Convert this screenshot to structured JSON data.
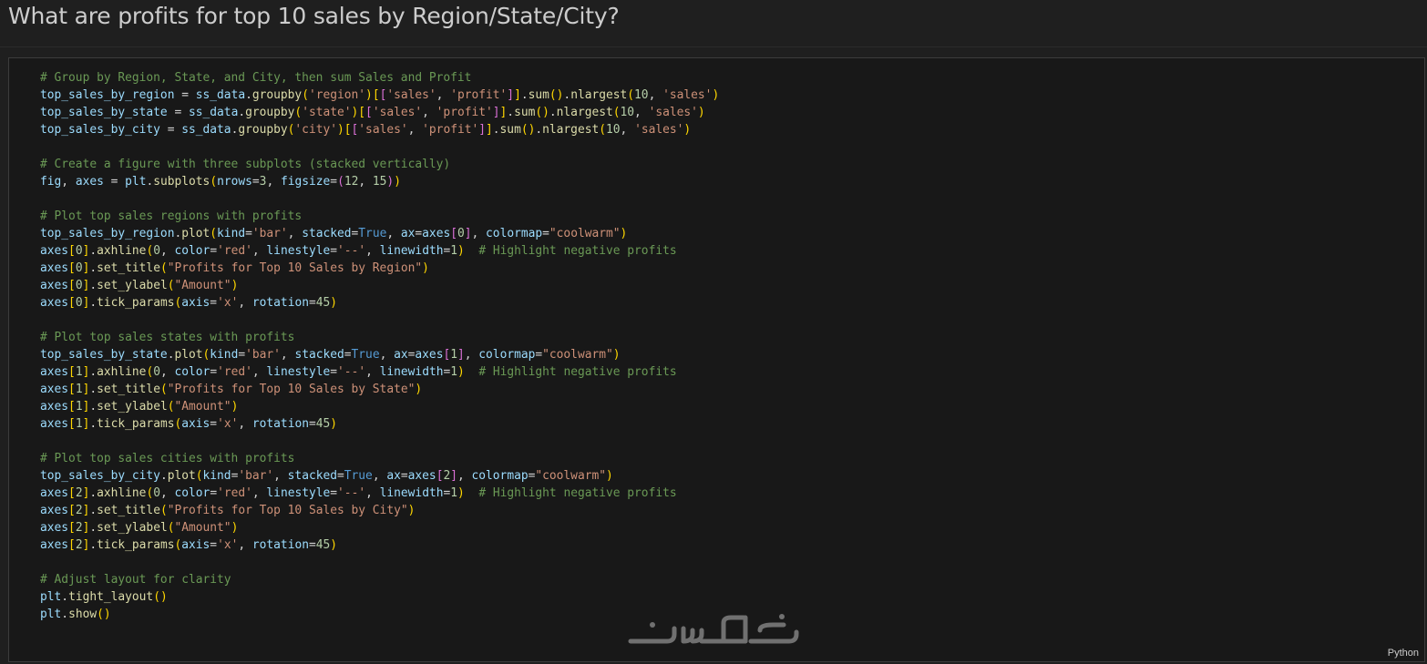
{
  "cell_heading": "What are profits for top 10 sales by Region/State/City?",
  "language_label": "Python",
  "watermark_text": "خدسات",
  "code_lines": [
    "# Group by Region, State, and City, then sum Sales and Profit",
    "top_sales_by_region = ss_data.groupby('region')[['sales', 'profit']].sum().nlargest(10, 'sales')",
    "top_sales_by_state = ss_data.groupby('state')[['sales', 'profit']].sum().nlargest(10, 'sales')",
    "top_sales_by_city = ss_data.groupby('city')[['sales', 'profit']].sum().nlargest(10, 'sales')",
    "",
    "# Create a figure with three subplots (stacked vertically)",
    "fig, axes = plt.subplots(nrows=3, figsize=(12, 15))",
    "",
    "# Plot top sales regions with profits",
    "top_sales_by_region.plot(kind='bar', stacked=True, ax=axes[0], colormap=\"coolwarm\")",
    "axes[0].axhline(0, color='red', linestyle='--', linewidth=1)  # Highlight negative profits",
    "axes[0].set_title(\"Profits for Top 10 Sales by Region\")",
    "axes[0].set_ylabel(\"Amount\")",
    "axes[0].tick_params(axis='x', rotation=45)",
    "",
    "# Plot top sales states with profits",
    "top_sales_by_state.plot(kind='bar', stacked=True, ax=axes[1], colormap=\"coolwarm\")",
    "axes[1].axhline(0, color='red', linestyle='--', linewidth=1)  # Highlight negative profits",
    "axes[1].set_title(\"Profits for Top 10 Sales by State\")",
    "axes[1].set_ylabel(\"Amount\")",
    "axes[1].tick_params(axis='x', rotation=45)",
    "",
    "# Plot top sales cities with profits",
    "top_sales_by_city.plot(kind='bar', stacked=True, ax=axes[2], colormap=\"coolwarm\")",
    "axes[2].axhline(0, color='red', linestyle='--', linewidth=1)  # Highlight negative profits",
    "axes[2].set_title(\"Profits for Top 10 Sales by City\")",
    "axes[2].set_ylabel(\"Amount\")",
    "axes[2].tick_params(axis='x', rotation=45)",
    "",
    "# Adjust layout for clarity",
    "plt.tight_layout()",
    "plt.show()"
  ],
  "theme": {
    "background": "#1f1f1f",
    "cell_background": "#181818",
    "comment": "#6a9955",
    "variable": "#9cdcfe",
    "function": "#dcdcaa",
    "string": "#ce9178",
    "number": "#b5cea8",
    "keyword": "#569cd6",
    "bracket_level_1": "#ffd700",
    "bracket_level_2": "#da70d6",
    "bracket_level_3": "#179fff"
  }
}
